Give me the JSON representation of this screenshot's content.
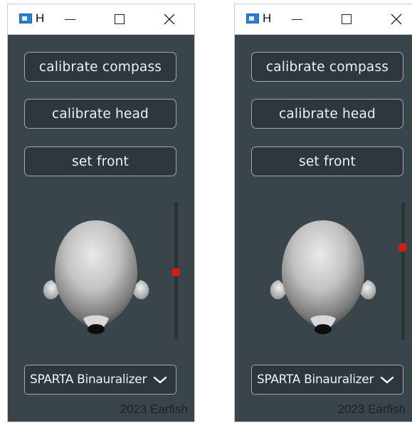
{
  "windows": [
    {
      "title": "H",
      "buttons": [
        "calibrate compass",
        "calibrate head",
        "set front"
      ],
      "slider_level": 0.49,
      "preset": "SPARTA Binauralizer",
      "footer": "2023 Earfish"
    },
    {
      "title": "H",
      "buttons": [
        "calibrate compass",
        "calibrate head",
        "set front"
      ],
      "slider_level": 0.67,
      "preset": "SPARTA Binauralizer",
      "footer": "2023 Earfish"
    }
  ],
  "icons": {
    "app": "app-window-icon",
    "minimize": "minimize-icon",
    "maximize": "maximize-icon",
    "close": "close-icon",
    "dropdown": "chevron-down-icon"
  },
  "colors": {
    "panel_background": "#3a454b",
    "button_background": "#2d373c",
    "button_border": "#9ea8ad",
    "slider_thumb": "#d61e0e",
    "footer_text": "#1b2124"
  }
}
